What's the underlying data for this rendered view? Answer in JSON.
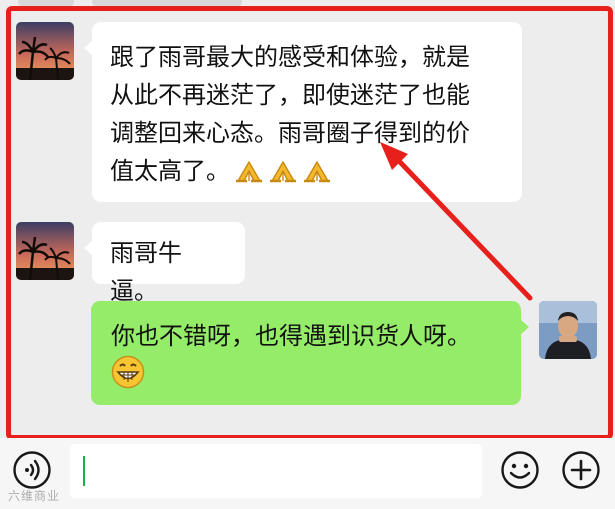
{
  "messages": [
    {
      "sender": "other",
      "text_lines": [
        "跟了雨哥最大的感受和体验，就是",
        "从此不再迷茫了，即使迷茫了也能",
        "调整回来心态。雨哥圈子得到的价",
        "值太高了。"
      ],
      "trailing_emoji": [
        "praying-hands",
        "praying-hands",
        "praying-hands"
      ]
    },
    {
      "sender": "other",
      "text": "雨哥牛逼。"
    },
    {
      "sender": "self",
      "text": "你也不错呀，也得遇到识货人呀。",
      "trailing_emoji": "grinning-face"
    }
  ],
  "annotation": {
    "highlight_color": "#e8201c",
    "arrow_color": "#e8201c"
  },
  "input_bar": {
    "left_icon": "voice-icon",
    "right_icons": [
      "emoji-icon",
      "plus-icon"
    ]
  },
  "watermark": "六维商业",
  "colors": {
    "self_bubble": "#95ec69",
    "other_bubble": "#ffffff",
    "background": "#ededed"
  }
}
